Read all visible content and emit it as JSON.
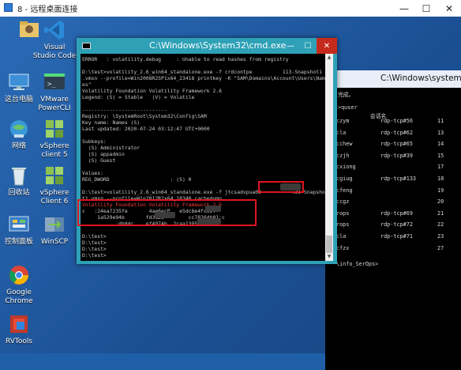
{
  "titlebar": {
    "title": "8 - 远程桌面连接",
    "minimize": "—",
    "maximize": "☐",
    "close": "✕"
  },
  "desktop_icons": [
    {
      "label": "",
      "name": "folder"
    },
    {
      "label": "Visual\nStudio Code",
      "name": "vscode"
    },
    {
      "label": "这台电脑",
      "name": "this-pc"
    },
    {
      "label": "VMware\nPowerCLI",
      "name": "vmware-powercli"
    },
    {
      "label": "网络",
      "name": "network"
    },
    {
      "label": "vSphere\nclient 5",
      "name": "vsphere-client-5"
    },
    {
      "label": "回收站",
      "name": "recycle-bin"
    },
    {
      "label": "vSphere\nClient 6",
      "name": "vsphere-client-6"
    },
    {
      "label": "控制面板",
      "name": "control-panel"
    },
    {
      "label": "WinSCP",
      "name": "winscp"
    },
    {
      "label": "Google\nChrome",
      "name": "google-chrome"
    },
    {
      "label": "RVTools",
      "name": "rvtools"
    }
  ],
  "cmd_front": {
    "title": "C:\\Windows\\System32\\cmd.exe",
    "lines": [
      {
        "text": "ERROR   : volatility.debug     : Unable to read hashes from registry",
        "red": false
      },
      {
        "text": "",
        "red": false
      },
      {
        "text": "D:\\test>volatility_2.6_win64_standalone.exe -f crdcontpe          113-Snapshot1",
        "red": false
      },
      {
        "text": ".vmsn --profile=Win2008R2SP1x64_23418 printkey -K \"SAM\\Domains\\Account\\Users\\Names",
        "red": false
      },
      {
        "text": "es\"",
        "red": false
      },
      {
        "text": "Volatility Foundation Volatility Framework 2.6",
        "red": false
      },
      {
        "text": "Legend: (S) = Stable   (V) = Volatile",
        "red": false
      },
      {
        "text": "",
        "red": false
      },
      {
        "text": "----------------------------",
        "red": false
      },
      {
        "text": "Registry: \\SystemRoot\\System32\\Config\\SAM",
        "red": false
      },
      {
        "text": "Key name: Names (S)",
        "red": false
      },
      {
        "text": "Last updated: 2020-07-24 03:12:47 UTC+0000",
        "red": false
      },
      {
        "text": "",
        "red": false
      },
      {
        "text": "Subkeys:",
        "red": false
      },
      {
        "text": "  (S) Administrator",
        "red": false
      },
      {
        "text": "  (S) appadmin",
        "red": false
      },
      {
        "text": "  (S) Guest",
        "red": false
      },
      {
        "text": "",
        "red": false
      },
      {
        "text": "Values:",
        "red": false
      },
      {
        "text": "REG_DWORD                    : (S) 0",
        "red": false
      },
      {
        "text": "",
        "red": false
      },
      {
        "text": "D:\\test>volatility_2.6_win64_standalone.exe -f jtcsadvpua02          .31-Snapsho",
        "red": false
      },
      {
        "text": "t1.vmsn --profile=Win2012R2x64_18340 cachedump",
        "red": false
      },
      {
        "text": "Volatility Foundation Volatility Framework 2.6",
        "red": true
      },
      {
        "text": "c   :24ea7235fe       4ae6ecP   e5dc8e4fc32:",
        "red": false
      },
      {
        "text": "     1a529e94b       fd3123        cc7826db01:c",
        "red": false
      },
      {
        "text": "           :db8dc    ef4974b  2caa13952545db8:",
        "red": false
      },
      {
        "text": "",
        "red": false
      },
      {
        "text": "D:\\test>",
        "red": false
      },
      {
        "text": "D:\\test>",
        "red": false
      },
      {
        "text": "D:\\test>",
        "red": false
      },
      {
        "text": "D:\\test>",
        "red": false
      }
    ]
  },
  "cmd_back": {
    "title": "C:\\Windows\\system",
    "header_lines": [
      "完成。",
      "",
      ">quser",
      "          会话名"
    ],
    "rows": [
      {
        "user": "czym",
        "session": "rdp-tcp#56",
        "id": "11"
      },
      {
        "user": "cla",
        "session": "rdp-tcp#62",
        "id": "13"
      },
      {
        "user": "cchew",
        "session": "rdp-tcp#65",
        "id": "14"
      },
      {
        "user": "czjh",
        "session": "rdp-tcp#39",
        "id": "15"
      },
      {
        "user": "cxiong",
        "session": "",
        "id": "17"
      },
      {
        "user": "cgiug",
        "session": "rdp-tcp#133",
        "id": "18"
      },
      {
        "user": "cfeng",
        "session": "",
        "id": "19"
      },
      {
        "user": "ccgz",
        "session": "",
        "id": "20"
      },
      {
        "user": "rops",
        "session": "rdp-tcp#69",
        "id": "21"
      },
      {
        "user": "rops",
        "session": "rdp-tcp#72",
        "id": "22"
      },
      {
        "user": "cla",
        "session": "rdp-tcp#71",
        "id": "23"
      },
      {
        "user": "cfzx",
        "session": "",
        "id": "27"
      }
    ],
    "footer": "\\info_SerOps>"
  }
}
